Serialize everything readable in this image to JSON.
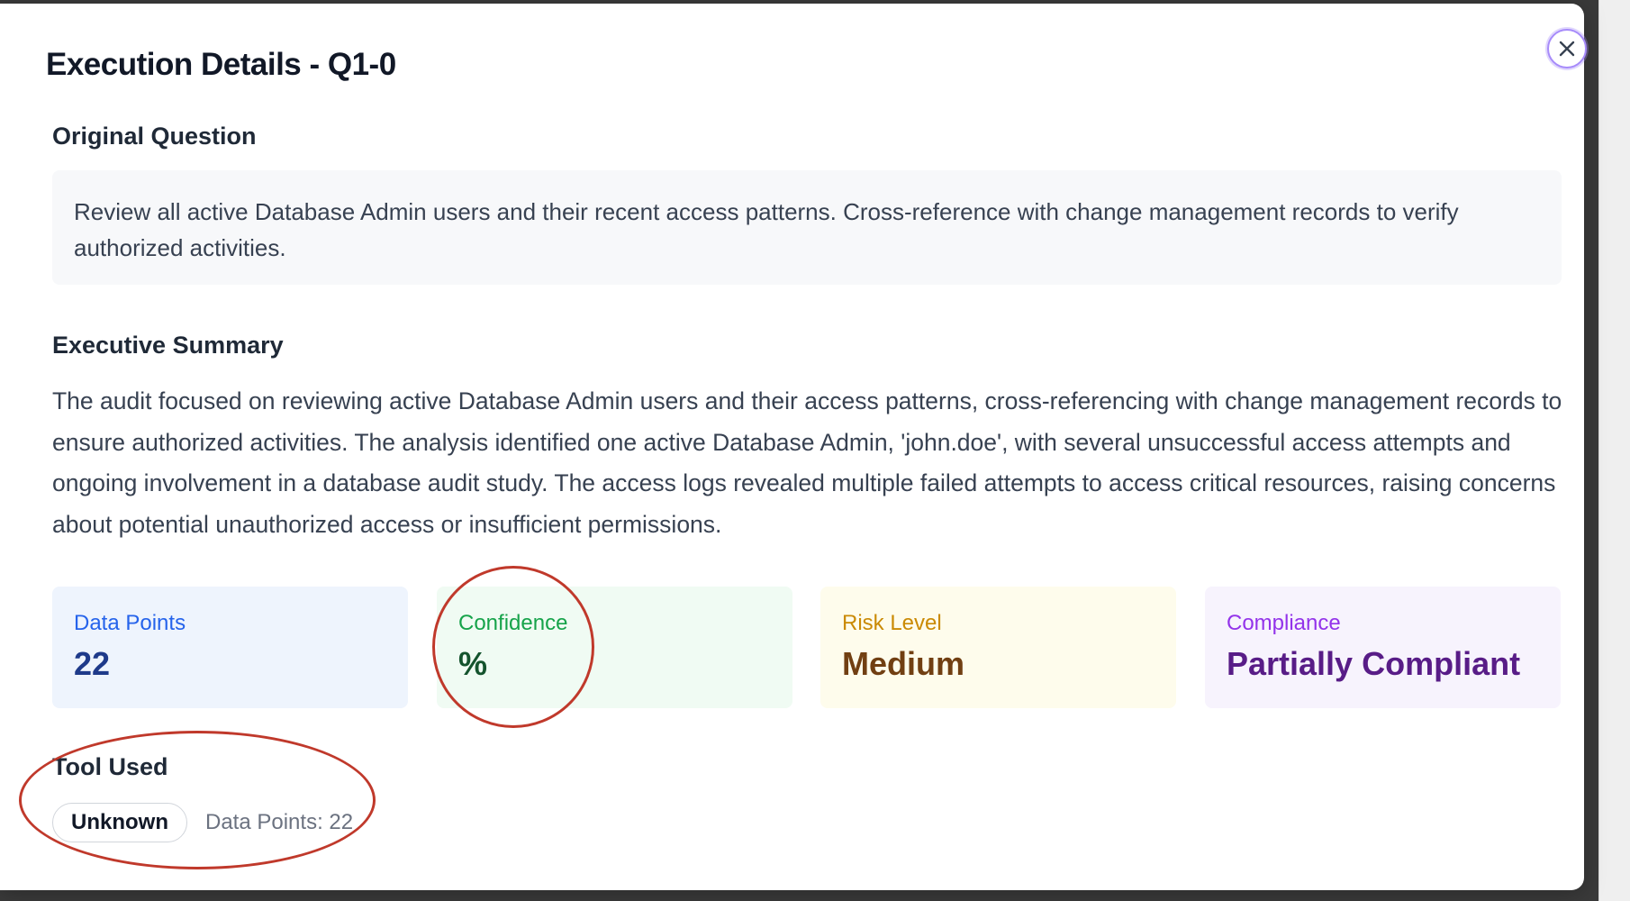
{
  "modal": {
    "title": "Execution Details - Q1-0"
  },
  "question": {
    "heading": "Original Question",
    "text": "Review all active Database Admin users and their recent access patterns. Cross-reference with change management records to verify authorized activities."
  },
  "summary": {
    "heading": "Executive Summary",
    "text": "The audit focused on reviewing active Database Admin users and their access patterns, cross-referencing with change management records to ensure authorized activities. The analysis identified one active Database Admin, 'john.doe', with several unsuccessful access attempts and ongoing involvement in a database audit study. The access logs revealed multiple failed attempts to access critical resources, raising concerns about potential unauthorized access or insufficient permissions."
  },
  "stats": {
    "data_points": {
      "label": "Data Points",
      "value": "22"
    },
    "confidence": {
      "label": "Confidence",
      "value": "%"
    },
    "risk": {
      "label": "Risk Level",
      "value": "Medium"
    },
    "compliance": {
      "label": "Compliance",
      "value": "Partially Compliant"
    }
  },
  "tool": {
    "heading": "Tool Used",
    "badge": "Unknown",
    "data_points_text": "Data Points: 22"
  },
  "colors": {
    "annotation": "#c0392b",
    "close_ring": "#a78bfa"
  },
  "icons": {
    "close": "close-icon"
  }
}
